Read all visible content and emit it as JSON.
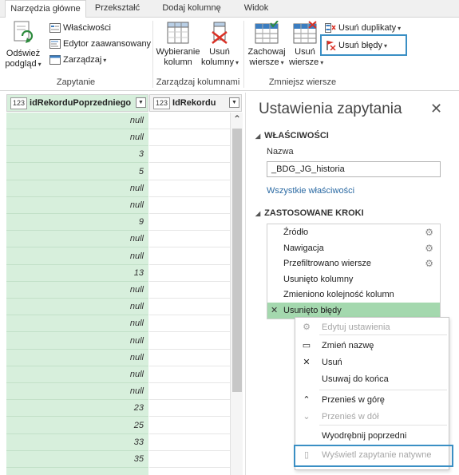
{
  "ribbon": {
    "tabs": [
      "Narzędzia główne",
      "Przekształć",
      "Dodaj kolumnę",
      "Widok"
    ],
    "groups": {
      "zapytanie": {
        "label": "Zapytanie",
        "refresh_line1": "Odśwież",
        "refresh_line2": "podgląd",
        "properties": "Właściwości",
        "advanced_editor": "Edytor zaawansowany",
        "manage": "Zarządzaj"
      },
      "kolumny": {
        "label": "Zarządzaj kolumnami",
        "choose_line1": "Wybieranie",
        "choose_line2": "kolumn",
        "remove_line1": "Usuń",
        "remove_line2": "kolumny"
      },
      "wiersze": {
        "label": "Zmniejsz wiersze",
        "keep_line1": "Zachowaj",
        "keep_line2": "wiersze",
        "remove_line1": "Usuń",
        "remove_line2": "wiersze",
        "remove_duplicates": "Usuń duplikaty",
        "remove_errors": "Usuń błędy"
      }
    }
  },
  "grid": {
    "columns": [
      {
        "type": "123",
        "name": "idRekorduPoprzedniego"
      },
      {
        "type": "123",
        "name": "IdRekordu"
      }
    ],
    "rows": [
      "null",
      "null",
      "3",
      "5",
      "null",
      "null",
      "9",
      "null",
      "null",
      "13",
      "null",
      "null",
      "null",
      "null",
      "null",
      "null",
      "null",
      "23",
      "25",
      "33",
      "35"
    ]
  },
  "pane": {
    "title": "Ustawienia zapytania",
    "properties_heading": "WŁAŚCIWOŚCI",
    "name_label": "Nazwa",
    "name_value": "_BDG_JG_historia",
    "all_properties_link": "Wszystkie właściwości",
    "steps_heading": "ZASTOSOWANE KROKI",
    "steps": [
      {
        "label": "Źródło",
        "gear": true
      },
      {
        "label": "Nawigacja",
        "gear": true
      },
      {
        "label": "Przefiltrowano wiersze",
        "gear": true
      },
      {
        "label": "Usunięto kolumny",
        "gear": false
      },
      {
        "label": "Zmieniono kolejność kolumn",
        "gear": false
      },
      {
        "label": "Usunięto błędy",
        "gear": false,
        "selected": true
      }
    ]
  },
  "context_menu": {
    "items": [
      {
        "label": "Edytuj ustawienia",
        "disabled": true,
        "icon": "gear-icon"
      },
      {
        "label": "Zmień nazwę",
        "disabled": false,
        "icon": "rename-icon"
      },
      {
        "label": "Usuń",
        "disabled": false,
        "icon": "delete-x-icon"
      },
      {
        "label": "Usuwaj do końca",
        "disabled": false,
        "icon": ""
      },
      {
        "label": "Przenieś w górę",
        "disabled": false,
        "icon": "chevron-up-icon"
      },
      {
        "label": "Przenieś w dół",
        "disabled": true,
        "icon": "chevron-down-icon"
      },
      {
        "label": "Wyodrębnij poprzedni",
        "disabled": false,
        "icon": ""
      },
      {
        "label": "Wyświetl zapytanie natywne",
        "disabled": true,
        "icon": "document-icon"
      }
    ]
  },
  "colors": {
    "selected_column": "#d7efdc",
    "selected_step": "#a4d8ae",
    "highlight_box": "#3a8fc4",
    "link": "#2b6aa3"
  }
}
